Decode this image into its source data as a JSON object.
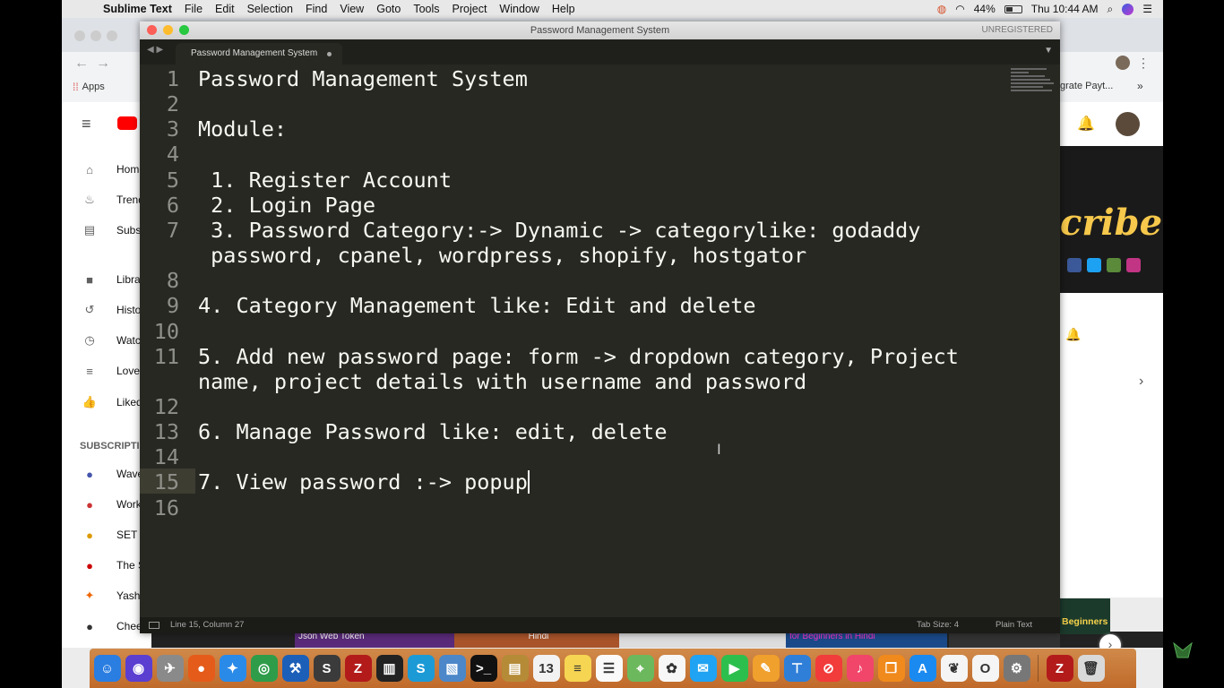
{
  "menubar": {
    "app_name": "Sublime Text",
    "items": [
      "File",
      "Edit",
      "Selection",
      "Find",
      "View",
      "Goto",
      "Tools",
      "Project",
      "Window",
      "Help"
    ],
    "battery": "44%",
    "battery_level": 0.44,
    "clock": "Thu 10:44 AM"
  },
  "chrome": {
    "bookmarks_apps": "Apps",
    "bookmark_right": "grate Payt..."
  },
  "youtube": {
    "sidebar": [
      {
        "label": "Home",
        "icon": "home-icon"
      },
      {
        "label": "Trending",
        "icon": "flame-icon"
      },
      {
        "label": "Subscriptions",
        "icon": "subscriptions-icon"
      },
      {
        "label": "Library",
        "icon": "folder-icon"
      },
      {
        "label": "History",
        "icon": "history-icon"
      },
      {
        "label": "Watch later",
        "icon": "clock-icon"
      },
      {
        "label": "Love",
        "icon": "playlist-icon"
      },
      {
        "label": "Liked",
        "icon": "thumbs-up-icon"
      }
    ],
    "subscriptions_header": "SUBSCRIPTIONS",
    "subscriptions": [
      "Wave",
      "Work",
      "SET",
      "The S",
      "Yash",
      "Chee"
    ],
    "banner_text": "cribe",
    "thumb_labels": [
      "Json Web Token",
      "Hindi",
      "for Beginners in Hindi",
      "Beginners in Hindi"
    ]
  },
  "sublime": {
    "window_title": "Password Management System",
    "unregistered": "UNREGISTERED",
    "tab_label": "Password Management System",
    "lines": [
      {
        "num": "1",
        "text": "Password Management System"
      },
      {
        "num": "2",
        "text": ""
      },
      {
        "num": "3",
        "text": "Module:"
      },
      {
        "num": "4",
        "text": ""
      },
      {
        "num": "5",
        "text": " 1. Register Account"
      },
      {
        "num": "6",
        "text": " 2. Login Page"
      },
      {
        "num": "7",
        "text": " 3. Password Category:-> Dynamic -> categorylike: godaddy"
      },
      {
        "num": "",
        "text": " password, cpanel, wordpress, shopify, hostgator"
      },
      {
        "num": "8",
        "text": ""
      },
      {
        "num": "9",
        "text": "4. Category Management like: Edit and delete"
      },
      {
        "num": "10",
        "text": ""
      },
      {
        "num": "11",
        "text": "5. Add new password page: form -> dropdown category, Project"
      },
      {
        "num": "",
        "text": "name, project details with username and password"
      },
      {
        "num": "12",
        "text": ""
      },
      {
        "num": "13",
        "text": "6. Manage Password like: edit, delete"
      },
      {
        "num": "14",
        "text": ""
      },
      {
        "num": "15",
        "text": "7. View password :-> popup"
      },
      {
        "num": "16",
        "text": ""
      }
    ],
    "status_position": "Line 15, Column 27",
    "status_tab_size": "Tab Size: 4",
    "status_syntax": "Plain Text"
  },
  "dock": {
    "icons": [
      {
        "name": "finder-icon",
        "color": "#2a7de1",
        "glyph": "☺"
      },
      {
        "name": "siri-icon",
        "color": "#5a3fd1",
        "glyph": "◉"
      },
      {
        "name": "launchpad-icon",
        "color": "#8a8a8a",
        "glyph": "✈"
      },
      {
        "name": "firefox-icon",
        "color": "#e55b1a",
        "glyph": "●"
      },
      {
        "name": "safari-icon",
        "color": "#2a8ae8",
        "glyph": "✦"
      },
      {
        "name": "chrome-icon",
        "color": "#2f9c4a",
        "glyph": "◎"
      },
      {
        "name": "xcode-icon",
        "color": "#1c5fb8",
        "glyph": "⚒"
      },
      {
        "name": "sublime-icon",
        "color": "#3b3b3b",
        "glyph": "S"
      },
      {
        "name": "filezilla-icon",
        "color": "#b31b1b",
        "glyph": "Z"
      },
      {
        "name": "activity-monitor-icon",
        "color": "#222",
        "glyph": "▥"
      },
      {
        "name": "skype-icon",
        "color": "#1c9ad6",
        "glyph": "S"
      },
      {
        "name": "preview-icon",
        "color": "#4b87c9",
        "glyph": "▧"
      },
      {
        "name": "terminal-icon",
        "color": "#111",
        "glyph": ">_"
      },
      {
        "name": "archive-icon",
        "color": "#b58b38",
        "glyph": "▤"
      },
      {
        "name": "calendar-icon",
        "color": "#f2f2f2",
        "glyph": "13"
      },
      {
        "name": "notes-icon",
        "color": "#f6d552",
        "glyph": "≡"
      },
      {
        "name": "reminders-icon",
        "color": "#fafafa",
        "glyph": "☰"
      },
      {
        "name": "maps-icon",
        "color": "#6cb85d",
        "glyph": "⌖"
      },
      {
        "name": "photos-icon",
        "color": "#f7f7f7",
        "glyph": "✿"
      },
      {
        "name": "messages-icon",
        "color": "#1fa3f2",
        "glyph": "✉"
      },
      {
        "name": "facetime-icon",
        "color": "#2dbf4e",
        "glyph": "▶"
      },
      {
        "name": "pages-icon",
        "color": "#f0a02c",
        "glyph": "✎"
      },
      {
        "name": "keynote-icon",
        "color": "#2f7fd8",
        "glyph": "⊤"
      },
      {
        "name": "news-icon",
        "color": "#f23b3b",
        "glyph": "⊘"
      },
      {
        "name": "music-icon",
        "color": "#f1456a",
        "glyph": "♪"
      },
      {
        "name": "books-icon",
        "color": "#f08a1c",
        "glyph": "❒"
      },
      {
        "name": "appstore-icon",
        "color": "#1a8af0",
        "glyph": "A"
      },
      {
        "name": "mongodb-icon",
        "color": "#f5f5f5",
        "glyph": "❦"
      },
      {
        "name": "opera-icon",
        "color": "#f5f5f5",
        "glyph": "O"
      },
      {
        "name": "system-preferences-icon",
        "color": "#777",
        "glyph": "⚙"
      },
      {
        "name": "filezilla2-icon",
        "color": "#b31b1b",
        "glyph": "Z"
      },
      {
        "name": "trash-icon",
        "color": "#d9d9d9",
        "glyph": "🗑"
      }
    ]
  }
}
